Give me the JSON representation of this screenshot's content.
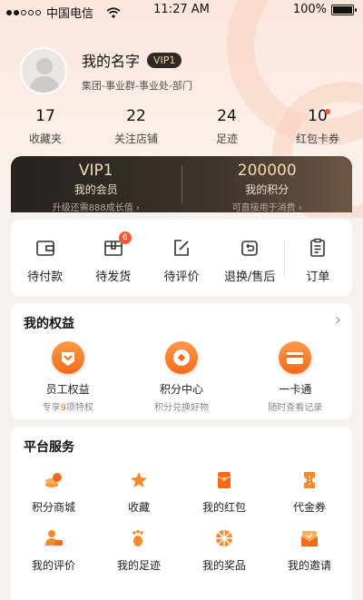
{
  "status_bar": {
    "carrier": "中国电信",
    "time": "11:27 AM",
    "battery": "100%",
    "icons": [
      "signal-icon",
      "wifi-icon",
      "battery-icon"
    ]
  },
  "profile": {
    "name": "我的名字",
    "vip_badge": "VIP1",
    "org": "集团-事业群-事业处-部门"
  },
  "stats": [
    {
      "value": "17",
      "label": "收藏夹"
    },
    {
      "value": "22",
      "label": "关注店铺"
    },
    {
      "value": "24",
      "label": "足迹"
    },
    {
      "value": "10",
      "label": "红包卡券"
    }
  ],
  "vip_card": {
    "member": {
      "title": "VIP1",
      "label": "我的会员",
      "sub": "升级还需888成长值 ›"
    },
    "points": {
      "title": "200000",
      "label": "我的积分",
      "sub": "可直接用于消费 ›"
    }
  },
  "orders": {
    "items": [
      {
        "label": "待付款",
        "icon": "wallet-icon"
      },
      {
        "label": "待发货",
        "icon": "package-icon",
        "badge": "6"
      },
      {
        "label": "待评价",
        "icon": "edit-icon"
      },
      {
        "label": "退换/售后",
        "icon": "return-icon"
      },
      {
        "label": "订单",
        "icon": "clipboard-icon"
      }
    ]
  },
  "rights": {
    "title": "我的权益",
    "items": [
      {
        "label": "员工权益",
        "sub_prefix": "专享",
        "sub_num": "9",
        "sub_suffix": "项特权",
        "icon": "crown-badge-icon"
      },
      {
        "label": "积分中心",
        "sub": "积分兑换好物",
        "icon": "coin-icon"
      },
      {
        "label": "一卡通",
        "sub": "随时查看记录",
        "icon": "card-icon"
      }
    ]
  },
  "services": {
    "title": "平台服务",
    "rows": [
      [
        {
          "label": "积分商城",
          "icon": "coin-stack-icon"
        },
        {
          "label": "收藏",
          "icon": "star-icon"
        },
        {
          "label": "我的红包",
          "icon": "red-packet-icon"
        },
        {
          "label": "代金券",
          "icon": "voucher-icon"
        }
      ],
      [
        {
          "label": "我的评价",
          "icon": "user-review-icon"
        },
        {
          "label": "我的足迹",
          "icon": "footprint-icon"
        },
        {
          "label": "我的奖品",
          "icon": "prize-icon"
        },
        {
          "label": "我的邀请",
          "icon": "invite-mail-icon"
        }
      ]
    ]
  },
  "colors": {
    "accent": "#f06a22",
    "dark_card": "#2f2a26",
    "gold": "#f7d9b4",
    "badge_red": "#f05b3a"
  }
}
